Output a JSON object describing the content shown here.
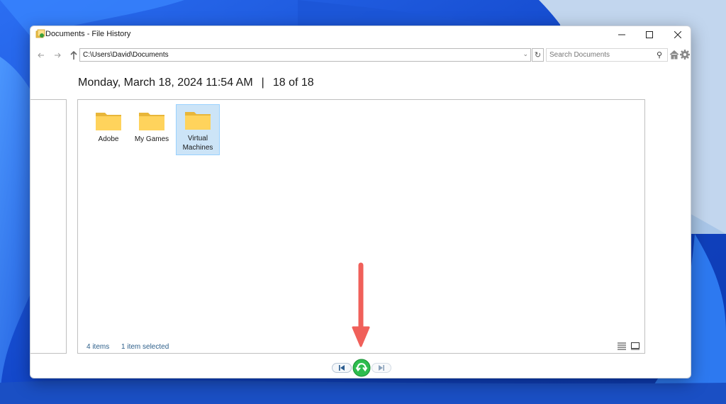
{
  "window": {
    "title": "Documents - File History",
    "minimize_icon": "minimize-icon",
    "maximize_icon": "maximize-icon",
    "close_icon": "close-icon"
  },
  "navbar": {
    "address": "C:\\Users\\David\\Documents",
    "search_placeholder": "Search Documents"
  },
  "header": {
    "date": "Monday, March 18, 2024 11:54 AM",
    "separator": "|",
    "position": "18 of 18"
  },
  "files": [
    {
      "name": "Adobe",
      "icon": "folder-icon",
      "selected": false
    },
    {
      "name": "My Games",
      "icon": "folder-icon",
      "selected": false
    },
    {
      "name": "Virtual Machines",
      "icon": "folder-icon",
      "selected": true
    }
  ],
  "status": {
    "items": "4 items",
    "selected": "1 item selected"
  },
  "colors": {
    "accent_green": "#2dbd4e",
    "selection": "#cce4f7",
    "annotation_arrow": "#f0605a"
  }
}
